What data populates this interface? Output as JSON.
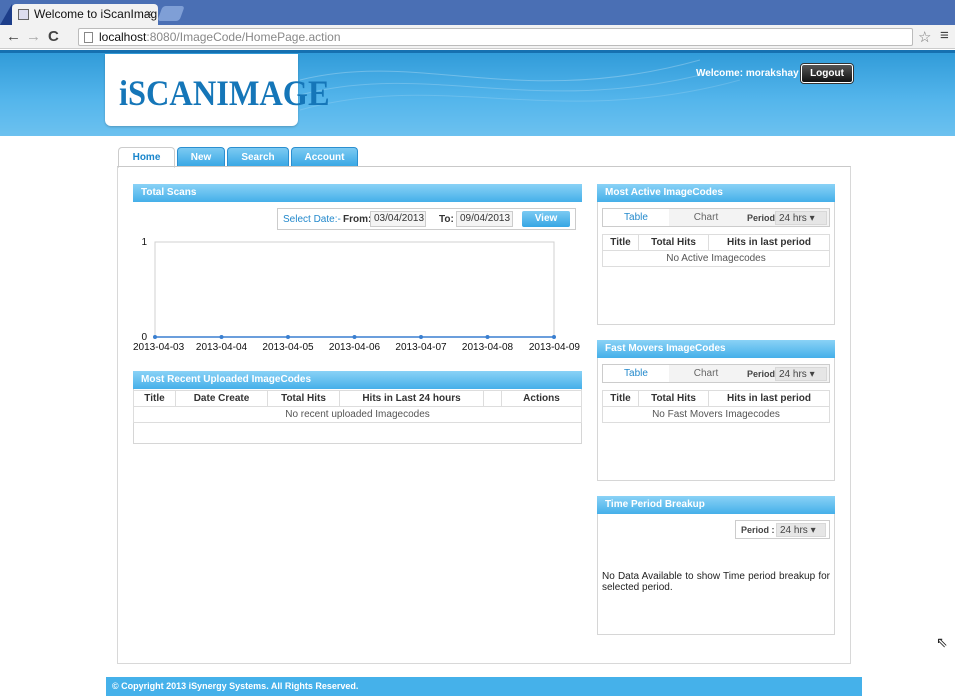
{
  "browser": {
    "tab_title": "Welcome to iScanImag",
    "tab_close": "×",
    "url_host": "localhost",
    "url_rest": ":8080/ImageCode/HomePage.action"
  },
  "header": {
    "logo": "iSCANIMAGE",
    "welcome": "Welcome: morakshay",
    "logout_label": "Logout"
  },
  "nav": {
    "tabs": [
      {
        "label": "Home"
      },
      {
        "label": "New"
      },
      {
        "label": "Search"
      },
      {
        "label": "Account"
      }
    ]
  },
  "total_scans": {
    "title": "Total Scans",
    "select_date": "Select Date:-",
    "from_label": "From:",
    "from_value": "03/04/2013",
    "to_label": "To:",
    "to_value": "09/04/2013",
    "view_label": "View"
  },
  "chart_data": {
    "type": "line",
    "x": [
      "2013-04-03",
      "2013-04-04",
      "2013-04-05",
      "2013-04-06",
      "2013-04-07",
      "2013-04-08",
      "2013-04-09"
    ],
    "series": [
      {
        "values": [
          0,
          0,
          0,
          0,
          0,
          0,
          0
        ]
      }
    ],
    "ylim": [
      0,
      1
    ],
    "yticks": [
      "0",
      "1"
    ],
    "color": "#3a7fd0"
  },
  "recent": {
    "title": "Most Recent Uploaded ImageCodes",
    "columns": [
      "Title",
      "Date Create",
      "Total Hits",
      "Hits in Last 24 hours",
      "",
      "Actions"
    ],
    "empty_message": "No recent uploaded Imagecodes"
  },
  "most_active": {
    "title": "Most Active ImageCodes",
    "tab_table": "Table",
    "tab_chart": "Chart",
    "period_label": "Period",
    "period_value": "24 hrs",
    "columns": [
      "Title",
      "Total Hits",
      "Hits in last period"
    ],
    "empty_message": "No Active Imagecodes"
  },
  "fast_movers": {
    "title": "Fast Movers ImageCodes",
    "tab_table": "Table",
    "tab_chart": "Chart",
    "period_label": "Period",
    "period_value": "24 hrs",
    "columns": [
      "Title",
      "Total Hits",
      "Hits in last period"
    ],
    "empty_message": "No Fast Movers Imagecodes"
  },
  "time_period": {
    "title": "Time Period Breakup",
    "period_label": "Period :",
    "period_value": "24 hrs",
    "message": "No Data Available to show Time period breakup for selected period."
  },
  "footer": {
    "copyright": "© Copyright 2013 iSynergy Systems. All Rights Reserved."
  },
  "colors": {
    "accent": "#45b1ea",
    "header_dark": "#2f9ad8",
    "link_blue": "#2389cc"
  }
}
